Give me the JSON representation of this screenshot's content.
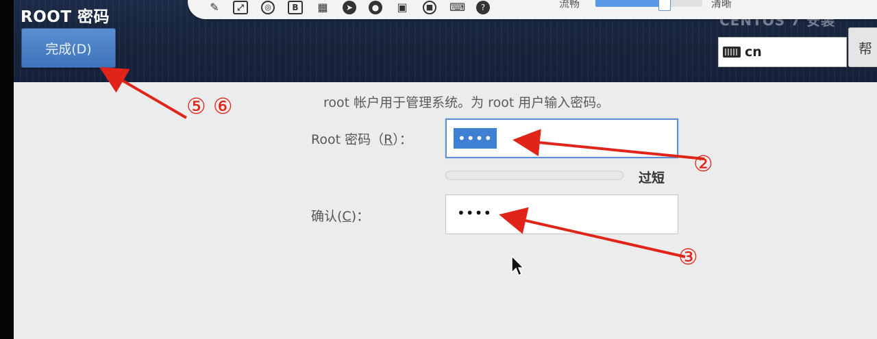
{
  "window": {
    "title": "ROOT 密码"
  },
  "header": {
    "done_label": "完成(D)",
    "faded_text": "CENTOS 7 安装"
  },
  "vm_toolbar": {
    "quality_low_label": "流畅",
    "quality_high_label": "清晰",
    "quality_level": 0.64,
    "icons": [
      "pin-icon",
      "fullscreen-icon",
      "disc-icon",
      "b-icon",
      "grid-icon",
      "send-icon",
      "cd-icon",
      "floppy-icon",
      "record-icon",
      "keyboard-icon",
      "help-icon"
    ]
  },
  "keyboard": {
    "layout": "cn"
  },
  "help_button": {
    "label": "帮"
  },
  "form": {
    "description": "root 帐户用于管理系统。为 root 用户输入密码。",
    "root_password_label_pre": "Root 密码（",
    "root_password_label_key": "R",
    "root_password_label_post": "）：",
    "root_password_value": "••••",
    "strength_text": "过短",
    "strength_level": 0.0,
    "confirm_label_pre": "确认(",
    "confirm_label_key": "C",
    "confirm_label_post": ")：",
    "confirm_value": "••••"
  },
  "annotations": {
    "done_step": "⑤ ⑥",
    "password_step": "②",
    "confirm_step": "③"
  },
  "colors": {
    "accent": "#3f74bb",
    "annotation": "#e0241a",
    "header_bg": "#18233a"
  }
}
